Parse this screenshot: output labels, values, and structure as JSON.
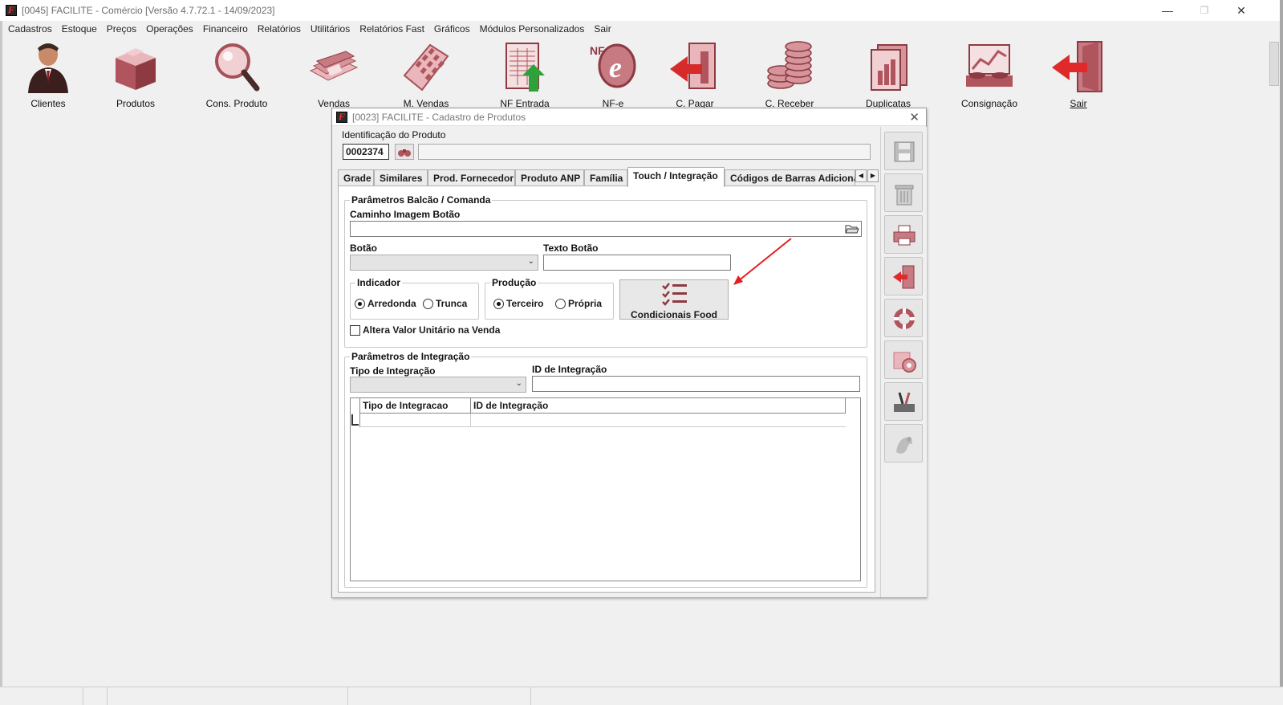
{
  "window": {
    "title": "[0045] FACILITE - Comércio [Versão 4.7.72.1 - 14/09/2023]",
    "controls": {
      "minimize": "—",
      "restore": "❐",
      "close": "✕"
    }
  },
  "menu": [
    "Cadastros",
    "Estoque",
    "Preços",
    "Operações",
    "Financeiro",
    "Relatórios",
    "Utilitários",
    "Relatórios Fast",
    "Gráficos",
    "Módulos Personalizados",
    "Sair"
  ],
  "toolbar": [
    {
      "label": "Clientes",
      "icon": "user-icon"
    },
    {
      "label": "Produtos",
      "icon": "box-icon"
    },
    {
      "label": "Cons. Produto",
      "icon": "magnifier-icon"
    },
    {
      "label": "Vendas",
      "icon": "money-icon"
    },
    {
      "label": "M. Vendas",
      "icon": "keypad-icon"
    },
    {
      "label": "NF Entrada",
      "icon": "invoice-in-icon"
    },
    {
      "label": "NF-e",
      "icon": "nfe-icon"
    },
    {
      "label": "C. Pagar",
      "icon": "pay-icon"
    },
    {
      "label": "C. Receber",
      "icon": "coins-icon"
    },
    {
      "label": "Duplicatas",
      "icon": "documents-icon"
    },
    {
      "label": "Consignação",
      "icon": "chart-icon"
    },
    {
      "label": "Sair",
      "icon": "exit-door-icon"
    }
  ],
  "dialog": {
    "title": "[0023] FACILITE - Cadastro de Produtos",
    "close": "✕",
    "identificacao_label": "Identificação do Produto",
    "product_code": "0002374",
    "product_name": "",
    "tabs": [
      "Grade",
      "Similares",
      "Prod. Fornecedor",
      "Produto ANP",
      "Família",
      "Touch / Integração",
      "Códigos de Barras Adicionais"
    ],
    "active_tab": "Touch / Integração",
    "tab_scroll": {
      "left": "◀",
      "right": "▶"
    },
    "balcao": {
      "legend": "Parâmetros Balcão / Comanda",
      "caminho_label": "Caminho Imagem Botão",
      "caminho_value": "",
      "botao_label": "Botão",
      "botao_value": "",
      "texto_botao_label": "Texto Botão",
      "texto_botao_value": "",
      "indicador": {
        "legend": "Indicador",
        "options": [
          "Arredonda",
          "Trunca"
        ],
        "selected": "Arredonda"
      },
      "producao": {
        "legend": "Produção",
        "options": [
          "Terceiro",
          "Própria"
        ],
        "selected": "Terceiro"
      },
      "condicionais_button": "Condicionais Food",
      "altera_valor_label": "Altera Valor Unitário na Venda",
      "altera_valor_checked": false
    },
    "integracao": {
      "legend": "Parâmetros de Integração",
      "tipo_label": "Tipo de Integração",
      "tipo_value": "",
      "id_label": "ID de Integração",
      "id_value": "",
      "grid_columns": [
        "Tipo de Integracao",
        "ID de Integração"
      ]
    },
    "sidebar_buttons": [
      "save-icon",
      "trash-icon",
      "printer-icon",
      "exit-icon",
      "lifebuoy-icon",
      "settings-icon",
      "tools-icon",
      "pets-icon"
    ]
  },
  "colors": {
    "icon_primary": "#b0555d",
    "icon_light": "#e9b7bb",
    "annotation_arrow": "#e81c1c",
    "green_arrow": "#2fa13a"
  }
}
